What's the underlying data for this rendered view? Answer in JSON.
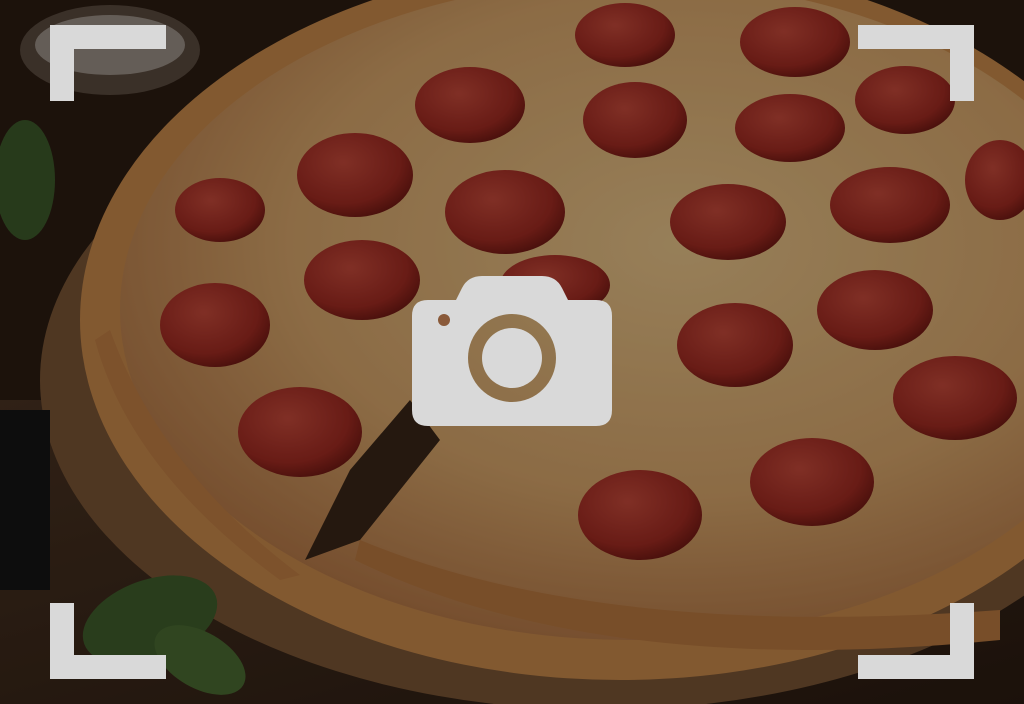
{
  "screen": {
    "description_icon": "camera-icon",
    "frame_icon": "viewfinder-corner"
  },
  "colors": {
    "overlay": "#d9d9d9",
    "dim": "rgba(0,0,0,0.35)"
  }
}
